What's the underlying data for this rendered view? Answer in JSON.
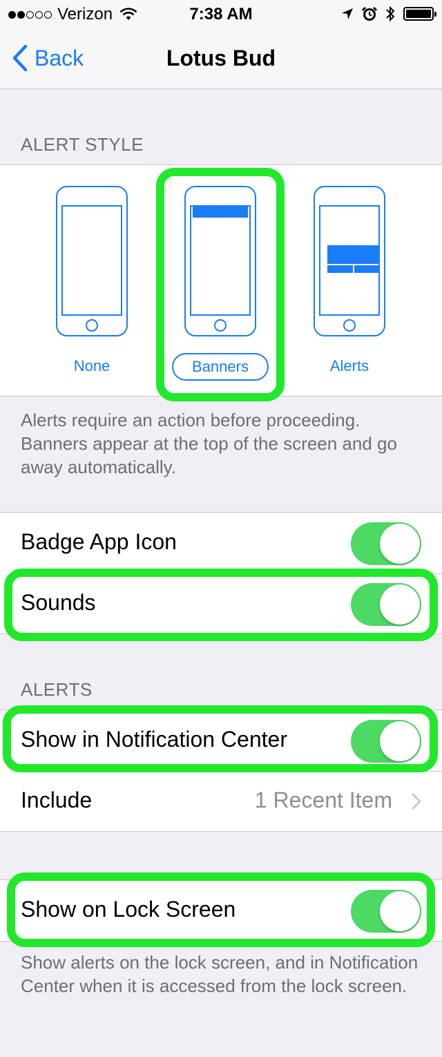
{
  "status": {
    "carrier": "Verizon",
    "time": "7:38 AM"
  },
  "nav": {
    "back_label": "Back",
    "title": "Lotus Bud"
  },
  "alert_style": {
    "header": "ALERT STYLE",
    "options": [
      {
        "label": "None"
      },
      {
        "label": "Banners",
        "selected": true
      },
      {
        "label": "Alerts"
      }
    ],
    "footer": "Alerts require an action before proceeding. Banners appear at the top of the screen and go away automatically."
  },
  "badge": {
    "label": "Badge App Icon",
    "on": true
  },
  "sounds": {
    "label": "Sounds",
    "on": true
  },
  "alerts_section": {
    "header": "ALERTS",
    "show_nc": {
      "label": "Show in Notification Center",
      "on": true
    },
    "include": {
      "label": "Include",
      "value": "1 Recent Item"
    }
  },
  "lock": {
    "label": "Show on Lock Screen",
    "on": true,
    "footer": "Show alerts on the lock screen, and in Notification Center when it is accessed from the lock screen."
  },
  "colors": {
    "accent": "#1a7cf6",
    "toggle_on": "#4cd964",
    "highlight": "#22e82c",
    "background": "#efeff4"
  }
}
